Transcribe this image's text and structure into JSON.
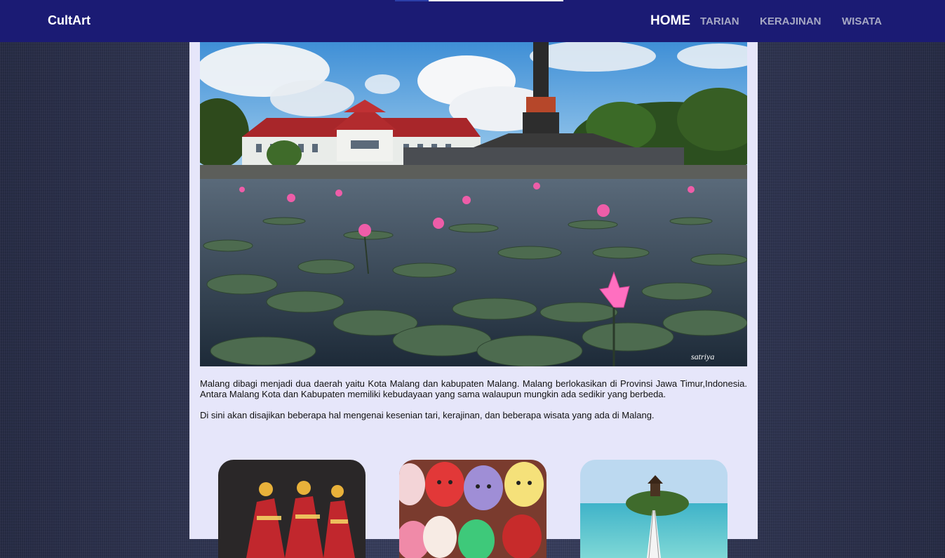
{
  "header": {
    "brand": "CultArt",
    "nav": [
      {
        "label": "HOME",
        "active": true
      },
      {
        "label": "TARIAN",
        "active": false
      },
      {
        "label": "KERAJINAN",
        "active": false
      },
      {
        "label": "WISATA",
        "active": false
      }
    ]
  },
  "main": {
    "paragraphs": [
      "Malang dibagi menjadi dua daerah yaitu Kota Malang dan kabupaten Malang. Malang berlokasikan di Provinsi Jawa Timur,Indonesia. Antara Malang Kota dan Kabupaten memiliki kebudayaan yang sama walaupun mungkin ada sedikir yang berbeda.",
      "Di sini akan disajikan beberapa hal mengenai kesenian tari, kerajinan, dan beberapa wisata yang ada di Malang."
    ],
    "hero_watermark": "satriya"
  },
  "colors": {
    "header_bg": "#1b1b74",
    "content_bg": "#e6e6fa",
    "nav_inactive": "#a6a8c4",
    "nav_active": "#ffffff"
  }
}
